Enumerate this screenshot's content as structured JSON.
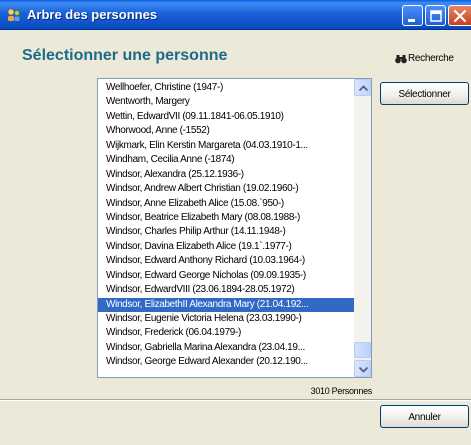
{
  "window": {
    "title": "Arbre des personnes"
  },
  "heading": "Sélectionner une personne",
  "search": {
    "label": "Recherche",
    "icon": "binoculars-icon"
  },
  "list": {
    "items": [
      "Wellhoefer, Christine (1947-)",
      "Wentworth, Margery",
      "Wettin, EdwardVII (09.11.1841-06.05.1910)",
      "Whorwood, Anne (-1552)",
      "Wijkmark, Elin Kerstin Margareta (04.03.1910-1...",
      "Windham, Cecilia Anne (-1874)",
      "Windsor, Alexandra (25.12.1936-)",
      "Windsor, Andrew Albert Christian (19.02.1960-)",
      "Windsor, Anne Elizabeth Alice (15.08.`950-)",
      "Windsor, Beatrice Elizabeth Mary (08.08.1988-)",
      "Windsor, Charles Philip Arthur (14.11.1948-)",
      "Windsor, Davina Elizabeth Alice (19.1`.1977-)",
      "Windsor, Edward Anthony Richard (10.03.1964-)",
      "Windsor, Edward George Nicholas (09.09.1935-)",
      "Windsor, EdwardVIII (23.06.1894-28.05.1972)",
      "Windsor, ElizabethII Alexandra Mary (21.04.192...",
      "Windsor, Eugenie Victoria Helena (23.03.1990-)",
      "Windsor, Frederick (06.04.1979-)",
      "Windsor, Gabriella Marina Alexandra (23.04.19...",
      "Windsor, George Edward Alexander (20.12.190..."
    ],
    "selected_index": 15
  },
  "buttons": {
    "select_label": "Sélectionner",
    "cancel_label": "Annuler"
  },
  "status": {
    "count_text": "3010 Personnes"
  },
  "colors": {
    "titlebar": "#0a5ae0",
    "heading": "#1d6a8a",
    "selection": "#316ac5",
    "window_bg": "#ece9d8"
  }
}
